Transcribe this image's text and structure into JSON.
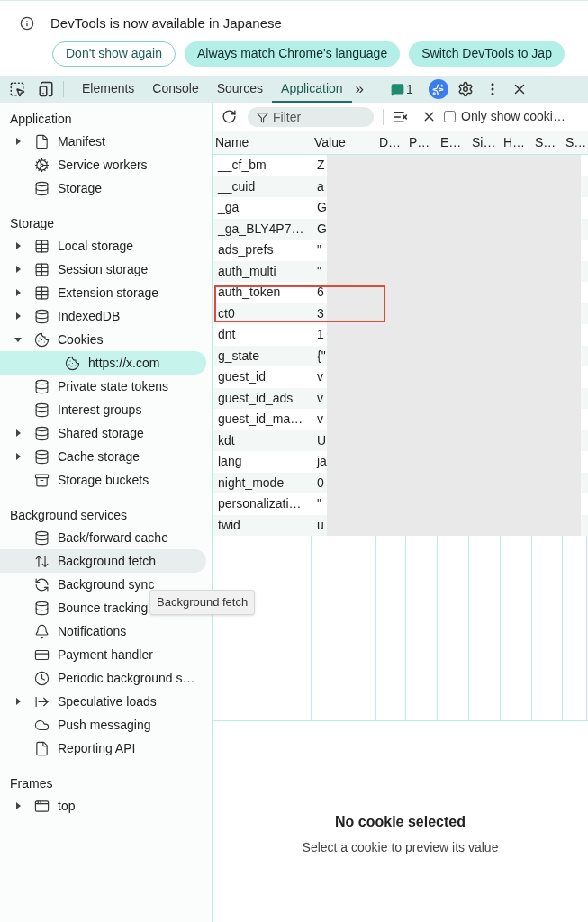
{
  "infobar": {
    "message": "DevTools is now available in Japanese",
    "buttons": [
      {
        "label": "Don't show again",
        "kind": "outline"
      },
      {
        "label": "Always match Chrome's language",
        "kind": "filled"
      },
      {
        "label": "Switch DevTools to Jap",
        "kind": "filled"
      }
    ]
  },
  "toolbar": {
    "tabs": [
      {
        "label": "Elements",
        "selected": false
      },
      {
        "label": "Console",
        "selected": false
      },
      {
        "label": "Sources",
        "selected": false
      },
      {
        "label": "Application",
        "selected": true
      }
    ],
    "more": "»",
    "issues_count": "1"
  },
  "filter_bar": {
    "placeholder": "Filter",
    "only_show_checkbox": {
      "label": "Only show cooki…",
      "checked": false
    }
  },
  "sidebar": [
    {
      "title": "Application",
      "items": [
        {
          "label": "Manifest",
          "kind": "file",
          "expanded": false,
          "selected": false,
          "hovered": false
        },
        {
          "label": "Service workers",
          "kind": "gears",
          "selected": false,
          "hovered": false
        },
        {
          "label": "Storage",
          "kind": "database",
          "selected": false,
          "hovered": false
        }
      ]
    },
    {
      "title": "Storage",
      "items": [
        {
          "label": "Local storage",
          "kind": "table",
          "expanded": false,
          "selected": false,
          "hovered": false
        },
        {
          "label": "Session storage",
          "kind": "table",
          "expanded": false,
          "selected": false,
          "hovered": false
        },
        {
          "label": "Extension storage",
          "kind": "table",
          "expanded": false,
          "selected": false,
          "hovered": false
        },
        {
          "label": "IndexedDB",
          "kind": "database",
          "expanded": false,
          "selected": false,
          "hovered": false
        },
        {
          "label": "Cookies",
          "kind": "cookie",
          "expanded": true,
          "selected": false,
          "hovered": false,
          "children": [
            {
              "label": "https://x.com",
              "kind": "cookie",
              "selected": true,
              "hovered": false
            }
          ]
        },
        {
          "label": "Private state tokens",
          "kind": "database",
          "selected": false,
          "hovered": false
        },
        {
          "label": "Interest groups",
          "kind": "database",
          "selected": false,
          "hovered": false
        },
        {
          "label": "Shared storage",
          "kind": "database",
          "expanded": false,
          "selected": false,
          "hovered": false
        },
        {
          "label": "Cache storage",
          "kind": "database",
          "expanded": false,
          "selected": false,
          "hovered": false
        },
        {
          "label": "Storage buckets",
          "kind": "bucket",
          "selected": false,
          "hovered": false
        }
      ]
    },
    {
      "title": "Background services",
      "items": [
        {
          "label": "Back/forward cache",
          "kind": "database",
          "selected": false,
          "hovered": false
        },
        {
          "label": "Background fetch",
          "kind": "updown",
          "selected": false,
          "hovered": true
        },
        {
          "label": "Background sync",
          "kind": "sync",
          "selected": false,
          "hovered": false
        },
        {
          "label": "Bounce tracking",
          "kind": "database",
          "selected": false,
          "hovered": false
        },
        {
          "label": "Notifications",
          "kind": "bell",
          "selected": false,
          "hovered": false
        },
        {
          "label": "Payment handler",
          "kind": "card",
          "selected": false,
          "hovered": false
        },
        {
          "label": "Periodic background s…",
          "kind": "clock",
          "selected": false,
          "hovered": false
        },
        {
          "label": "Speculative loads",
          "kind": "speculative",
          "expanded": false,
          "selected": false,
          "hovered": false
        },
        {
          "label": "Push messaging",
          "kind": "cloud",
          "selected": false,
          "hovered": false
        },
        {
          "label": "Reporting API",
          "kind": "file",
          "selected": false,
          "hovered": false
        }
      ]
    },
    {
      "title": "Frames",
      "items": [
        {
          "label": "top",
          "kind": "window",
          "expanded": false,
          "selected": false,
          "hovered": false
        }
      ]
    }
  ],
  "table": {
    "columns": [
      "Name",
      "Value",
      "D…",
      "P…",
      "E…",
      "Si…",
      "H…",
      "S…",
      "S…"
    ],
    "rows": [
      {
        "name": "__cf_bm",
        "value": "Z"
      },
      {
        "name": "__cuid",
        "value": "a"
      },
      {
        "name": "_ga",
        "value": "G"
      },
      {
        "name": "_ga_BLY4P7…",
        "value": "G"
      },
      {
        "name": "ads_prefs",
        "value": "\""
      },
      {
        "name": "auth_multi",
        "value": "\""
      },
      {
        "name": "auth_token",
        "value": "6"
      },
      {
        "name": "ct0",
        "value": "3"
      },
      {
        "name": "dnt",
        "value": "1"
      },
      {
        "name": "g_state",
        "value": "{\""
      },
      {
        "name": "guest_id",
        "value": "v"
      },
      {
        "name": "guest_id_ads",
        "value": "v"
      },
      {
        "name": "guest_id_ma…",
        "value": "v"
      },
      {
        "name": "kdt",
        "value": "U"
      },
      {
        "name": "lang",
        "value": "ja"
      },
      {
        "name": "night_mode",
        "value": "0"
      },
      {
        "name": "personalizati…",
        "value": "\""
      },
      {
        "name": "twid",
        "value": "u"
      }
    ]
  },
  "preview": {
    "title": "No cookie selected",
    "hint": "Select a cookie to preview its value"
  },
  "tooltip": "Background fetch"
}
